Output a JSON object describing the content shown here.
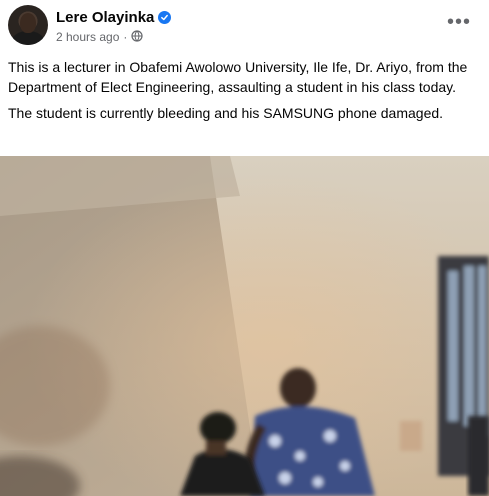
{
  "post": {
    "author_name": "Lere Olayinka",
    "verified_icon": "verified-badge-icon",
    "timestamp": "2 hours ago",
    "separator": "·",
    "audience_icon": "globe-icon",
    "more_icon": "more-options-icon",
    "more_glyph": "•••",
    "paragraphs": [
      "This is a lecturer in Obafemi Awolowo University, Ile Ife, Dr. Ariyo, from the Department of Elect Engineering, assaulting a student in his class today.",
      "The student is currently bleeding and his SAMSUNG phone damaged."
    ]
  },
  "colors": {
    "text_primary": "#050505",
    "text_secondary": "#65676b",
    "verified_blue": "#1877f2",
    "background": "#ffffff"
  }
}
